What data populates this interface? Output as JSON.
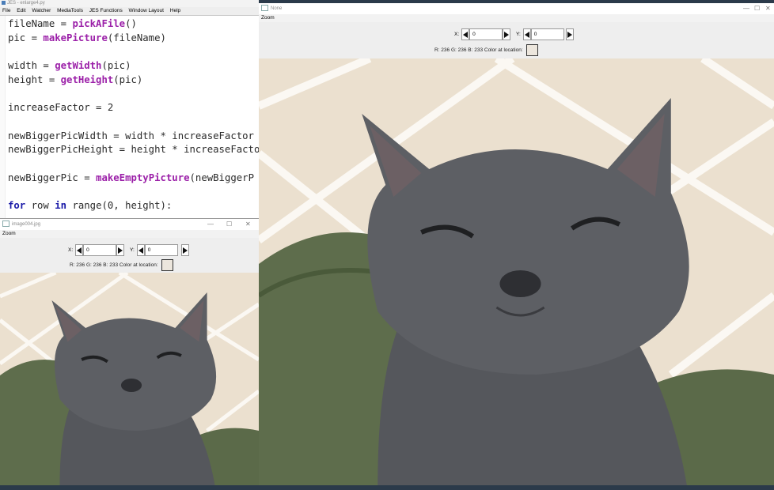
{
  "editor": {
    "title": "JES - enlarge4.py",
    "menu": [
      "File",
      "Edit",
      "Watcher",
      "MediaTools",
      "JES Functions",
      "Window Layout",
      "Help"
    ],
    "code_lines": [
      {
        "pre": "fileName = ",
        "fn": "pickAFile",
        "post": "()"
      },
      {
        "pre": "pic = ",
        "fn": "makePicture",
        "post": "(fileName)"
      },
      {
        "pre": "",
        "fn": "",
        "post": ""
      },
      {
        "pre": "width = ",
        "fn": "getWidth",
        "post": "(pic)"
      },
      {
        "pre": "height = ",
        "fn": "getHeight",
        "post": "(pic)"
      },
      {
        "pre": "",
        "fn": "",
        "post": ""
      },
      {
        "pre": "increaseFactor = 2",
        "fn": "",
        "post": ""
      },
      {
        "pre": "",
        "fn": "",
        "post": ""
      },
      {
        "pre": "newBiggerPicWidth = width * increaseFactor",
        "fn": "",
        "post": ""
      },
      {
        "pre": "newBiggerPicHeight = height * increaseFacto",
        "fn": "",
        "post": ""
      },
      {
        "pre": "",
        "fn": "",
        "post": ""
      },
      {
        "pre": "newBiggerPic = ",
        "fn": "makeEmptyPicture",
        "post": "(newBiggerP"
      },
      {
        "pre": "",
        "fn": "",
        "post": ""
      },
      {
        "pre": "",
        "kw": "for",
        "mid": " row ",
        "kw2": "in",
        "post": " range(0, height):"
      }
    ]
  },
  "big_window": {
    "title": "None",
    "menu": "Zoom",
    "x_label": "X:",
    "x_value": "0",
    "y_label": "Y:",
    "y_value": "0",
    "color_text": "R: 236 G: 236 B: 233 Color at location:",
    "controls": [
      "—",
      "☐",
      "✕"
    ]
  },
  "small_window": {
    "title": "image004.jpg",
    "menu": "Zoom",
    "x_label": "X:",
    "x_value": "0",
    "y_label": "Y:",
    "y_value": "0",
    "color_text": "R: 236 G: 236 B: 233 Color at location:",
    "controls": [
      "—",
      "☐",
      "✕"
    ]
  },
  "colors": {
    "swatch": "#ece6dd",
    "tile": "#ebe0cf",
    "grout": "#fbf8f3",
    "cat": "#5d5f64",
    "couch": "#5e6d4c"
  },
  "icons": {
    "left_arrow": "left-arrow-icon",
    "right_arrow": "right-arrow-icon",
    "picture": "picture-icon"
  }
}
